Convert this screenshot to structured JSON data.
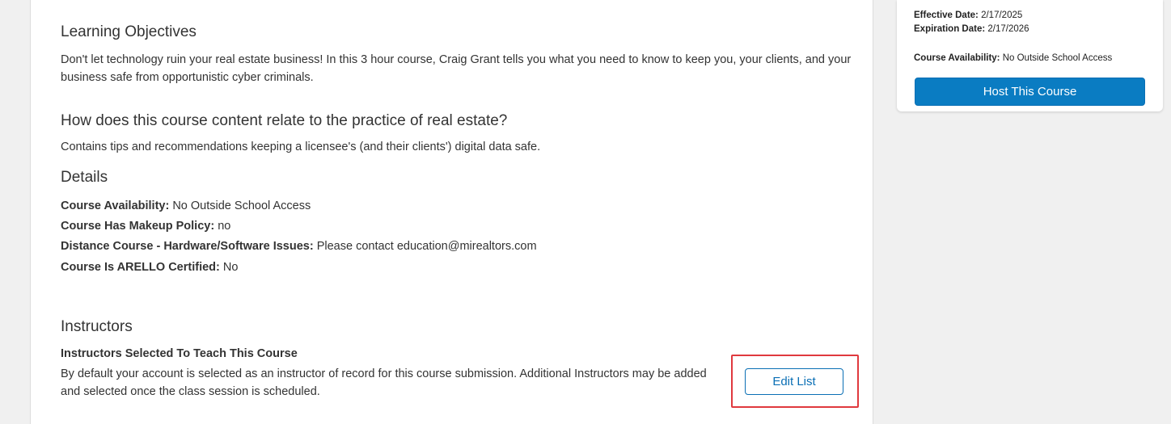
{
  "learning_objectives": {
    "heading": "Learning Objectives",
    "text": "Don't let technology ruin your real estate business! In this 3 hour course, Craig Grant tells you what you need to know to keep you, your clients, and your business safe from opportunistic cyber criminals."
  },
  "relation": {
    "heading": "How does this course content relate to the practice of real estate?",
    "text": "Contains tips and recommendations keeping a licensee's (and their clients') digital data safe."
  },
  "details": {
    "heading": "Details",
    "items": [
      {
        "label": "Course Availability:",
        "value": "No Outside School Access"
      },
      {
        "label": "Course Has Makeup Policy:",
        "value": "no"
      },
      {
        "label": "Distance Course - Hardware/Software Issues:",
        "value": "Please contact education@mirealtors.com"
      },
      {
        "label": "Course Is ARELLO Certified:",
        "value": "No"
      }
    ]
  },
  "instructors": {
    "heading": "Instructors",
    "subheading": "Instructors Selected To Teach This Course",
    "text": "By default your account is selected as an instructor of record for this course submission. Additional Instructors may be added and selected once the class session is scheduled.",
    "edit_button": "Edit List"
  },
  "sidebar": {
    "effective_label": "Effective Date:",
    "effective_value": "2/17/2025",
    "expiration_label": "Expiration Date:",
    "expiration_value": "2/17/2026",
    "availability_label": "Course Availability:",
    "availability_value": "No Outside School Access",
    "host_button": "Host This Course"
  },
  "colors": {
    "accent": "#0a7cc2",
    "highlight": "#e0393e"
  }
}
